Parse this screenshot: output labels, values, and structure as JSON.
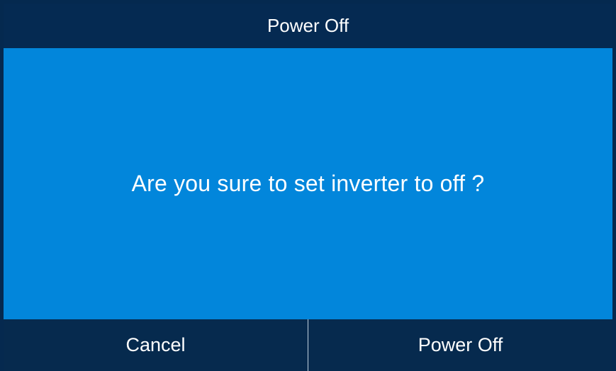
{
  "dialog": {
    "title": "Power Off",
    "message": "Are you sure to set inverter to off ?",
    "buttons": {
      "cancel": "Cancel",
      "confirm": "Power Off"
    }
  },
  "colors": {
    "frame": "#05294f",
    "titlebar": "#052a52",
    "content": "#0286db",
    "footer": "#062a4e",
    "text": "#ffffff",
    "divider": "#d7e4f1"
  }
}
